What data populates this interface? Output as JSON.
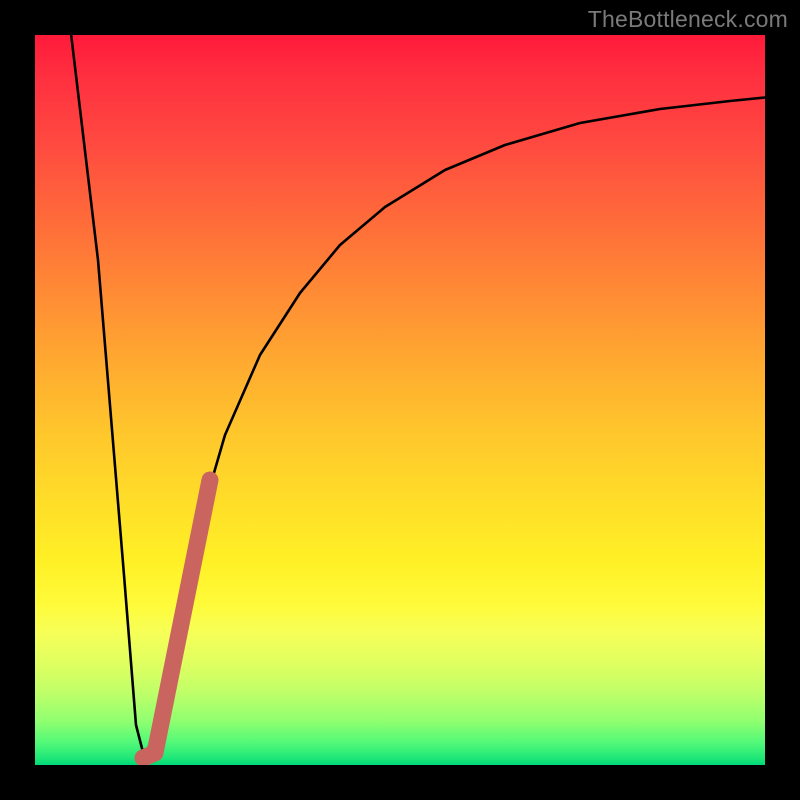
{
  "watermark": "TheBottleneck.com",
  "colors": {
    "frame": "#000000",
    "curve": "#000000",
    "marker": "#c9655e",
    "gradient_top": "#ff1a3a",
    "gradient_bottom": "#00d878"
  },
  "chart_data": {
    "type": "line",
    "title": "",
    "xlabel": "",
    "ylabel": "",
    "xlim": [
      0,
      100
    ],
    "ylim": [
      0,
      100
    ],
    "grid": false,
    "legend": false,
    "series": [
      {
        "name": "bottleneck-curve",
        "x": [
          0,
          5,
          10,
          12,
          14,
          16,
          18,
          20,
          24,
          28,
          32,
          36,
          40,
          46,
          52,
          60,
          70,
          80,
          90,
          100
        ],
        "y": [
          100,
          60,
          20,
          4,
          0,
          10,
          22,
          34,
          50,
          60,
          68,
          74,
          78,
          82,
          85,
          88,
          90,
          91.5,
          92.5,
          93
        ]
      }
    ],
    "marker_segment": {
      "name": "highlighted-range",
      "x": [
        14,
        23
      ],
      "y": [
        1,
        43
      ]
    },
    "minimum": {
      "x": 14,
      "y": 0
    }
  }
}
